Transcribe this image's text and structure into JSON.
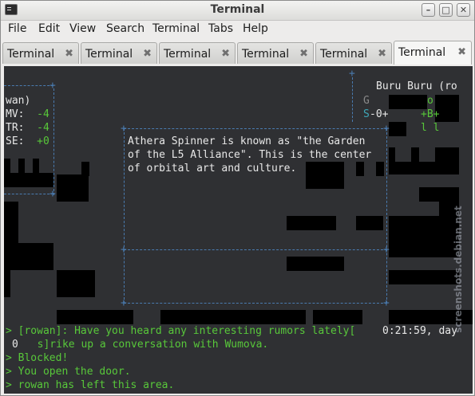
{
  "window": {
    "title": "Terminal",
    "controls": {
      "minimize": "–",
      "maximize": "□",
      "close": "✕"
    }
  },
  "menu": [
    "File",
    "Edit",
    "View",
    "Search",
    "Terminal",
    "Tabs",
    "Help"
  ],
  "tabs": [
    {
      "label": "Terminal",
      "active": false
    },
    {
      "label": "Terminal",
      "active": false
    },
    {
      "label": "Terminal",
      "active": false
    },
    {
      "label": "Terminal",
      "active": false
    },
    {
      "label": "Terminal",
      "active": false
    },
    {
      "label": "Terminal",
      "active": true
    }
  ],
  "stats": [
    {
      "text": "wan)",
      "value": ""
    },
    {
      "text": "MV:  ",
      "value": "-4"
    },
    {
      "text": "TR:  ",
      "value": "-4"
    },
    {
      "text": "SE:  ",
      "value": "+0"
    }
  ],
  "location": {
    "name": "Buru Buru (ro",
    "row1": {
      "a": "G",
      "b": "o"
    },
    "row2": {
      "a": "S",
      "b": "-0+",
      "c": "+B+"
    },
    "row3": {
      "a": "l l"
    }
  },
  "popup_text": [
    "Athera Spinner is known as \"the Garden",
    "of the L5 Alliance\". This is the center",
    "of orbital art and culture."
  ],
  "log": [
    {
      "text": "> [rowan]: Have you heard any interesting rumors lately[",
      "color": "green"
    },
    {
      "text": "  s]rike up a conversation with Wumova.",
      "color": "green"
    },
    {
      "text": "> Blocked!",
      "color": "green"
    },
    {
      "text": "> You open the door.",
      "color": "green"
    },
    {
      "text": "> rowan has left this area.",
      "color": "green"
    }
  ],
  "clock": "0:21:59, day",
  "log_counter": "0",
  "watermark": "screenshots.debian.net"
}
